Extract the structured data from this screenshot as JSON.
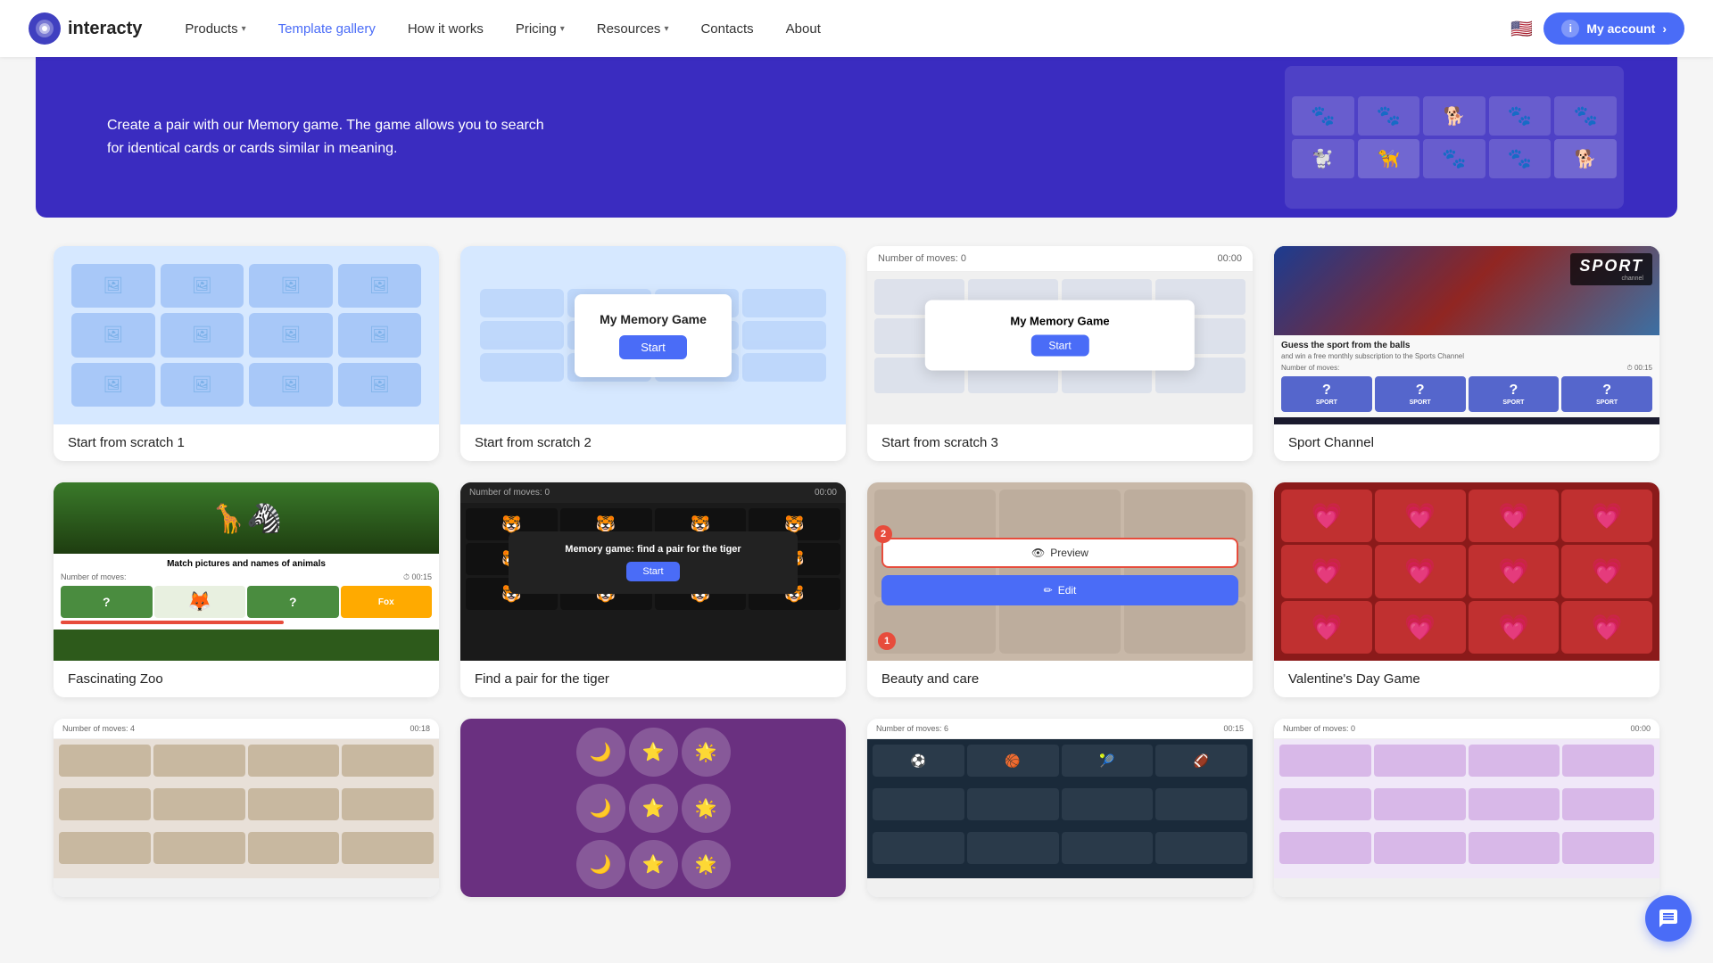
{
  "brand": {
    "name": "interacty",
    "logo_alt": "interacty logo"
  },
  "nav": {
    "items": [
      {
        "id": "products",
        "label": "Products",
        "has_arrow": true,
        "active": false
      },
      {
        "id": "template-gallery",
        "label": "Template gallery",
        "has_arrow": false,
        "active": true
      },
      {
        "id": "how-it-works",
        "label": "How it works",
        "has_arrow": false,
        "active": false
      },
      {
        "id": "pricing",
        "label": "Pricing",
        "has_arrow": true,
        "active": false
      },
      {
        "id": "resources",
        "label": "Resources",
        "has_arrow": true,
        "active": false
      },
      {
        "id": "contacts",
        "label": "Contacts",
        "has_arrow": false,
        "active": false
      },
      {
        "id": "about",
        "label": "About",
        "has_arrow": false,
        "active": false
      }
    ],
    "my_account": "My account"
  },
  "hero": {
    "description": "Create a pair with our Memory game. The game allows you to search for identical cards or cards similar in meaning."
  },
  "templates": {
    "row1": [
      {
        "id": "scratch1",
        "title": "Start from scratch 1",
        "type": "scratch1"
      },
      {
        "id": "scratch2",
        "title": "Start from scratch 2",
        "type": "scratch2",
        "modal_title": "My Memory Game",
        "modal_btn": "Start"
      },
      {
        "id": "scratch3",
        "title": "Start from scratch 3",
        "type": "scratch3",
        "header_moves": "Number of moves: 0",
        "header_time": "00:00",
        "modal_title": "My Memory Game",
        "modal_btn": "Start"
      },
      {
        "id": "sport-channel",
        "title": "Sport Channel",
        "type": "sport",
        "guess_text": "Guess the sport from the balls",
        "sub_text": "and win a free monthly subscription to the Sports Channel",
        "sport_word": "SPORT"
      }
    ],
    "row2": [
      {
        "id": "zoo",
        "title": "Fascinating Zoo",
        "type": "zoo",
        "match_text": "Match pictures and names of animals",
        "fox_label": "Fox"
      },
      {
        "id": "tiger",
        "title": "Find a pair for the tiger",
        "type": "tiger",
        "header_moves": "Number of moves: 0",
        "header_time": "00:00",
        "modal_title": "Memory game: find a pair for the tiger",
        "modal_btn": "Start"
      },
      {
        "id": "beauty",
        "title": "Beauty and care",
        "type": "beauty",
        "preview_label": "Preview",
        "edit_label": "Edit",
        "badge1": "1",
        "badge2": "2"
      },
      {
        "id": "valentine",
        "title": "Valentine's Day Game",
        "type": "valentine",
        "heart_emoji": "💗"
      }
    ],
    "row3_partial": [
      {
        "id": "row3-1",
        "title": "",
        "type": "bottom1",
        "header_moves": "Number of moves: 4",
        "header_time": "00:18"
      },
      {
        "id": "row3-2",
        "title": "",
        "type": "bottom2",
        "bg_color": "#6a3080"
      },
      {
        "id": "row3-3",
        "title": "",
        "type": "bottom3",
        "header_moves": "Number of moves: 6",
        "header_time": "00:15"
      },
      {
        "id": "row3-4",
        "title": "",
        "type": "bottom4",
        "header_moves": "Number of moves: 0",
        "header_time": "00:00"
      }
    ]
  },
  "chat_btn": {
    "label": "chat"
  }
}
